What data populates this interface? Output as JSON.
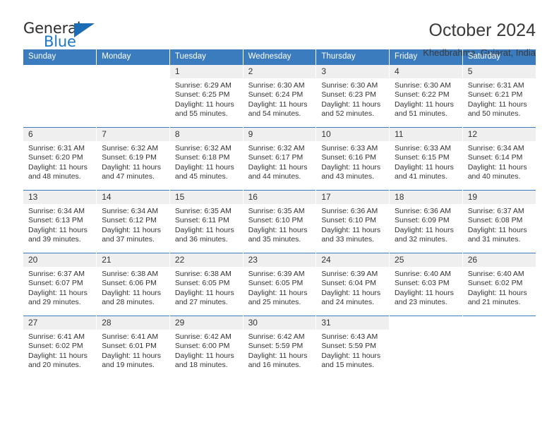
{
  "brand": {
    "name_top": "General",
    "name_bottom": "Blue",
    "triangle_color": "#1b6cb5",
    "blue_color": "#1b77c4"
  },
  "header": {
    "title": "October 2024",
    "subtitle": "Khedbrahma, Gujarat, India"
  },
  "theme": {
    "header_blue": "#3b7cbf",
    "day_band_gray": "#efefef",
    "text": "#333333"
  },
  "weekdays": [
    "Sunday",
    "Monday",
    "Tuesday",
    "Wednesday",
    "Thursday",
    "Friday",
    "Saturday"
  ],
  "labels": {
    "sunrise": "Sunrise:",
    "sunset": "Sunset:",
    "daylight": "Daylight:"
  },
  "weeks": [
    [
      {
        "day": "",
        "blank": true
      },
      {
        "day": "",
        "blank": true
      },
      {
        "day": "1",
        "sunrise": "Sunrise: 6:29 AM",
        "sunset": "Sunset: 6:25 PM",
        "daylight": "Daylight: 11 hours and 55 minutes."
      },
      {
        "day": "2",
        "sunrise": "Sunrise: 6:30 AM",
        "sunset": "Sunset: 6:24 PM",
        "daylight": "Daylight: 11 hours and 54 minutes."
      },
      {
        "day": "3",
        "sunrise": "Sunrise: 6:30 AM",
        "sunset": "Sunset: 6:23 PM",
        "daylight": "Daylight: 11 hours and 52 minutes."
      },
      {
        "day": "4",
        "sunrise": "Sunrise: 6:30 AM",
        "sunset": "Sunset: 6:22 PM",
        "daylight": "Daylight: 11 hours and 51 minutes."
      },
      {
        "day": "5",
        "sunrise": "Sunrise: 6:31 AM",
        "sunset": "Sunset: 6:21 PM",
        "daylight": "Daylight: 11 hours and 50 minutes."
      }
    ],
    [
      {
        "day": "6",
        "sunrise": "Sunrise: 6:31 AM",
        "sunset": "Sunset: 6:20 PM",
        "daylight": "Daylight: 11 hours and 48 minutes."
      },
      {
        "day": "7",
        "sunrise": "Sunrise: 6:32 AM",
        "sunset": "Sunset: 6:19 PM",
        "daylight": "Daylight: 11 hours and 47 minutes."
      },
      {
        "day": "8",
        "sunrise": "Sunrise: 6:32 AM",
        "sunset": "Sunset: 6:18 PM",
        "daylight": "Daylight: 11 hours and 45 minutes."
      },
      {
        "day": "9",
        "sunrise": "Sunrise: 6:32 AM",
        "sunset": "Sunset: 6:17 PM",
        "daylight": "Daylight: 11 hours and 44 minutes."
      },
      {
        "day": "10",
        "sunrise": "Sunrise: 6:33 AM",
        "sunset": "Sunset: 6:16 PM",
        "daylight": "Daylight: 11 hours and 43 minutes."
      },
      {
        "day": "11",
        "sunrise": "Sunrise: 6:33 AM",
        "sunset": "Sunset: 6:15 PM",
        "daylight": "Daylight: 11 hours and 41 minutes."
      },
      {
        "day": "12",
        "sunrise": "Sunrise: 6:34 AM",
        "sunset": "Sunset: 6:14 PM",
        "daylight": "Daylight: 11 hours and 40 minutes."
      }
    ],
    [
      {
        "day": "13",
        "sunrise": "Sunrise: 6:34 AM",
        "sunset": "Sunset: 6:13 PM",
        "daylight": "Daylight: 11 hours and 39 minutes."
      },
      {
        "day": "14",
        "sunrise": "Sunrise: 6:34 AM",
        "sunset": "Sunset: 6:12 PM",
        "daylight": "Daylight: 11 hours and 37 minutes."
      },
      {
        "day": "15",
        "sunrise": "Sunrise: 6:35 AM",
        "sunset": "Sunset: 6:11 PM",
        "daylight": "Daylight: 11 hours and 36 minutes."
      },
      {
        "day": "16",
        "sunrise": "Sunrise: 6:35 AM",
        "sunset": "Sunset: 6:10 PM",
        "daylight": "Daylight: 11 hours and 35 minutes."
      },
      {
        "day": "17",
        "sunrise": "Sunrise: 6:36 AM",
        "sunset": "Sunset: 6:10 PM",
        "daylight": "Daylight: 11 hours and 33 minutes."
      },
      {
        "day": "18",
        "sunrise": "Sunrise: 6:36 AM",
        "sunset": "Sunset: 6:09 PM",
        "daylight": "Daylight: 11 hours and 32 minutes."
      },
      {
        "day": "19",
        "sunrise": "Sunrise: 6:37 AM",
        "sunset": "Sunset: 6:08 PM",
        "daylight": "Daylight: 11 hours and 31 minutes."
      }
    ],
    [
      {
        "day": "20",
        "sunrise": "Sunrise: 6:37 AM",
        "sunset": "Sunset: 6:07 PM",
        "daylight": "Daylight: 11 hours and 29 minutes."
      },
      {
        "day": "21",
        "sunrise": "Sunrise: 6:38 AM",
        "sunset": "Sunset: 6:06 PM",
        "daylight": "Daylight: 11 hours and 28 minutes."
      },
      {
        "day": "22",
        "sunrise": "Sunrise: 6:38 AM",
        "sunset": "Sunset: 6:05 PM",
        "daylight": "Daylight: 11 hours and 27 minutes."
      },
      {
        "day": "23",
        "sunrise": "Sunrise: 6:39 AM",
        "sunset": "Sunset: 6:05 PM",
        "daylight": "Daylight: 11 hours and 25 minutes."
      },
      {
        "day": "24",
        "sunrise": "Sunrise: 6:39 AM",
        "sunset": "Sunset: 6:04 PM",
        "daylight": "Daylight: 11 hours and 24 minutes."
      },
      {
        "day": "25",
        "sunrise": "Sunrise: 6:40 AM",
        "sunset": "Sunset: 6:03 PM",
        "daylight": "Daylight: 11 hours and 23 minutes."
      },
      {
        "day": "26",
        "sunrise": "Sunrise: 6:40 AM",
        "sunset": "Sunset: 6:02 PM",
        "daylight": "Daylight: 11 hours and 21 minutes."
      }
    ],
    [
      {
        "day": "27",
        "sunrise": "Sunrise: 6:41 AM",
        "sunset": "Sunset: 6:02 PM",
        "daylight": "Daylight: 11 hours and 20 minutes."
      },
      {
        "day": "28",
        "sunrise": "Sunrise: 6:41 AM",
        "sunset": "Sunset: 6:01 PM",
        "daylight": "Daylight: 11 hours and 19 minutes."
      },
      {
        "day": "29",
        "sunrise": "Sunrise: 6:42 AM",
        "sunset": "Sunset: 6:00 PM",
        "daylight": "Daylight: 11 hours and 18 minutes."
      },
      {
        "day": "30",
        "sunrise": "Sunrise: 6:42 AM",
        "sunset": "Sunset: 5:59 PM",
        "daylight": "Daylight: 11 hours and 16 minutes."
      },
      {
        "day": "31",
        "sunrise": "Sunrise: 6:43 AM",
        "sunset": "Sunset: 5:59 PM",
        "daylight": "Daylight: 11 hours and 15 minutes."
      },
      {
        "day": "",
        "blank": true
      },
      {
        "day": "",
        "blank": true
      }
    ]
  ]
}
